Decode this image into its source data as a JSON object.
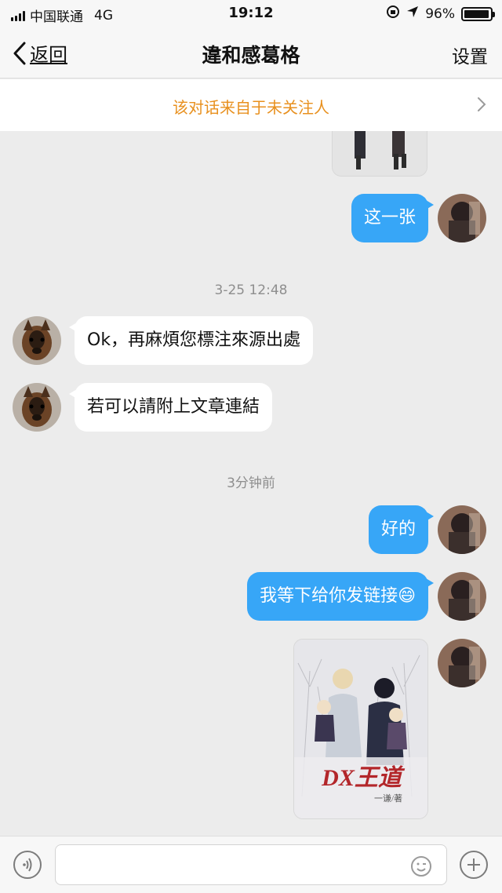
{
  "status_bar": {
    "carrier": "中国联通",
    "network": "4G",
    "time": "19:12",
    "battery_percent": "96%",
    "battery_level": 0.96
  },
  "nav": {
    "back_label": "返回",
    "title": "違和感葛格",
    "settings_label": "设置"
  },
  "notice": {
    "text": "该对话来自于未关注人"
  },
  "messages": {
    "m1_text": "这一张",
    "ts1": "3-25 12:48",
    "m2_text": "Ok，再麻煩您標注來源出處",
    "m3_text": "若可以請附上文章連結",
    "ts2": "3分钟前",
    "m4_text": "好的",
    "m5_text": "我等下给你发链接😄"
  },
  "book_cover": {
    "title_text": "DX王道",
    "author_text": "一谦/著"
  },
  "colors": {
    "outgoing_bubble": "#37a6f7",
    "incoming_bubble": "#ffffff",
    "notice_text": "#e8901e",
    "background": "#ececec"
  }
}
